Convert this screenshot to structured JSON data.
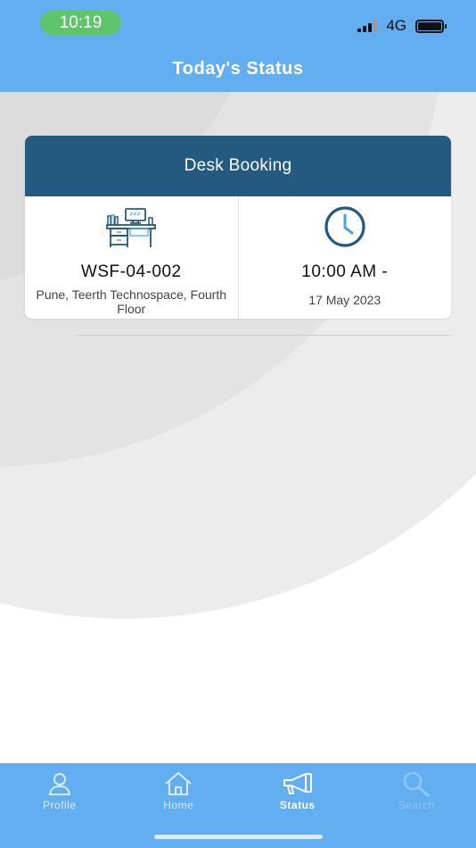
{
  "status_bar": {
    "time": "10:19",
    "network": "4G"
  },
  "header": {
    "title": "Today's Status"
  },
  "booking_card": {
    "title": "Desk Booking",
    "desk": {
      "code": "WSF-04-002",
      "location": "Pune, Teerth Technospace, Fourth Floor",
      "icon": "desk-icon"
    },
    "time": {
      "value": "10:00 AM -",
      "date": "17 May 2023",
      "icon": "clock-icon"
    }
  },
  "tabbar": {
    "tabs": [
      {
        "label": "Profile",
        "icon": "profile-icon",
        "active": false
      },
      {
        "label": "Home",
        "icon": "home-icon",
        "active": false
      },
      {
        "label": "Status",
        "icon": "status-icon",
        "active": true
      },
      {
        "label": "Search",
        "icon": "search-icon",
        "active": false
      }
    ]
  },
  "colors": {
    "header_bg": "#63aef0",
    "card_header_bg": "#245a80",
    "status_time_bg": "#5fc46a",
    "icon_dark": "#245a80",
    "icon_light": "#4aa3df"
  }
}
